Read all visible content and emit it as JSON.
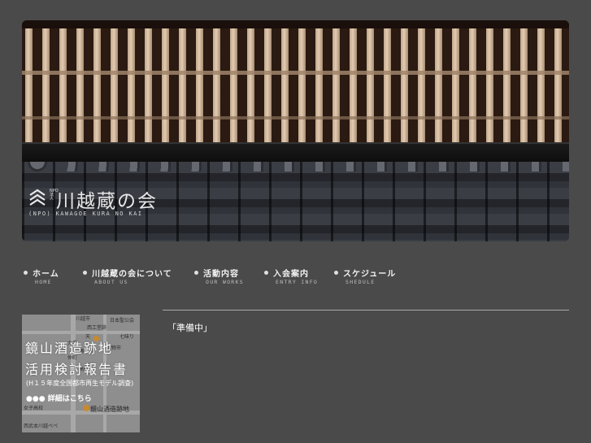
{
  "header": {
    "logo_small": "NPO法人",
    "logo_title": "川越蔵の会",
    "logo_roman": "(NPO) KAWAGOE KURA NO KAI"
  },
  "nav": [
    {
      "label": "ホーム",
      "sub": "HOME"
    },
    {
      "label": "川越蔵の会について",
      "sub": "ABOUT US"
    },
    {
      "label": "活動内容",
      "sub": "OUR WORKS"
    },
    {
      "label": "入会案内",
      "sub": "ENTRY INFO"
    },
    {
      "label": "スケジュール",
      "sub": "SHEDULE"
    }
  ],
  "promo": {
    "title_line1": "鏡山酒造跡地",
    "title_line2": "活用検討報告書",
    "note": "(H１５年度全国都市再生モデル調査)",
    "link": "●●● 詳細はこちら",
    "pin_label": "鏡山酒造跡地",
    "map_labels": [
      "川越市",
      "日本聖公会",
      "西工堂跡",
      "大手",
      "仲町",
      "七味り",
      "織物市",
      "高校",
      "女子高校",
      "西武本川越ペペ",
      "鏡山通",
      "天"
    ]
  },
  "content": {
    "text": "「準備中」"
  },
  "colors": {
    "background": "#4a4a4a",
    "accent_pin": "#c88a2e",
    "divider": "#a9a9a9"
  }
}
